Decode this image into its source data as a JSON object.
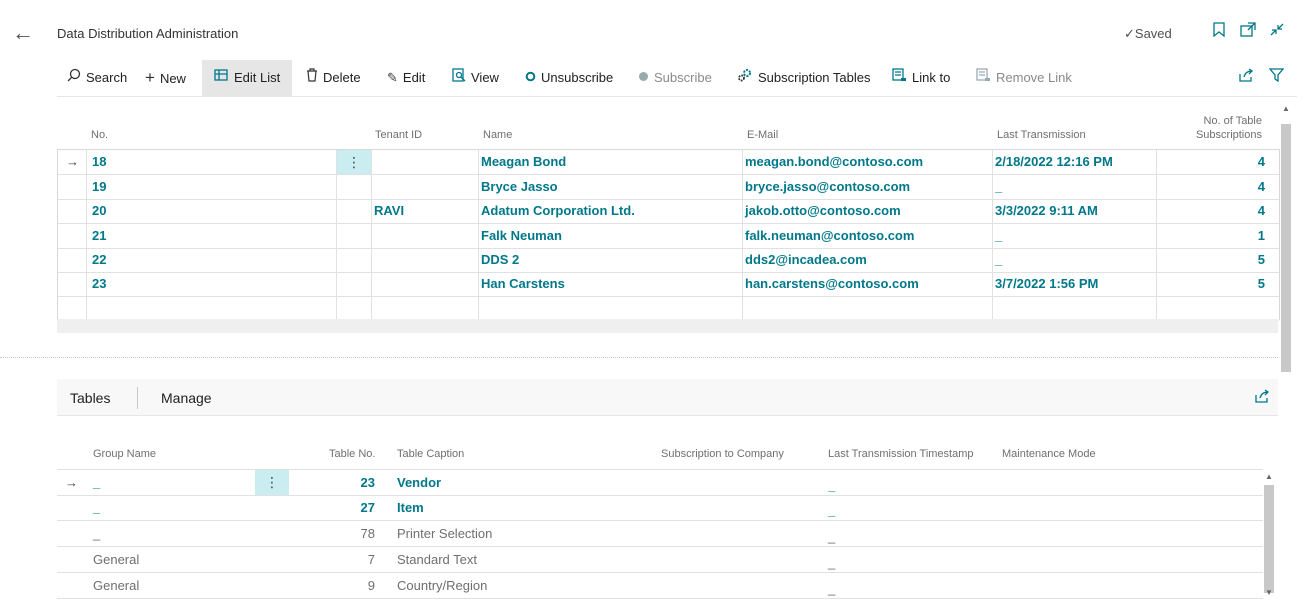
{
  "header": {
    "title": "Data Distribution Administration",
    "saved_label": "Saved"
  },
  "actions": [
    {
      "label": "Search",
      "icon": "search-icon",
      "state": "normal"
    },
    {
      "label": "New",
      "icon": "plus-icon",
      "state": "normal"
    },
    {
      "label": "Edit List",
      "icon": "edit-list-icon",
      "state": "active"
    },
    {
      "label": "Delete",
      "icon": "trash-icon",
      "state": "normal"
    },
    {
      "label": "Edit",
      "icon": "pencil-icon",
      "state": "normal"
    },
    {
      "label": "View",
      "icon": "view-icon",
      "state": "normal"
    },
    {
      "label": "Unsubscribe",
      "icon": "ring-icon",
      "state": "normal"
    },
    {
      "label": "Subscribe",
      "icon": "dot-icon",
      "state": "disabled"
    },
    {
      "label": "Subscription Tables",
      "icon": "gears-icon",
      "state": "normal"
    },
    {
      "label": "Link to",
      "icon": "link-doc-icon",
      "state": "normal"
    },
    {
      "label": "Remove Link",
      "icon": "remove-link-icon",
      "state": "disabled"
    }
  ],
  "main_grid": {
    "columns": {
      "no": "No.",
      "tenant_id": "Tenant ID",
      "name": "Name",
      "email": "E-Mail",
      "last_transmission": "Last Transmission",
      "subs_line1": "No. of Table",
      "subs_line2": "Subscriptions"
    },
    "rows": [
      {
        "no": "18",
        "tenant": "",
        "name": "Meagan Bond",
        "email": "meagan.bond@contoso.com",
        "last": "2/18/2022 12:16 PM",
        "subs": "4"
      },
      {
        "no": "19",
        "tenant": "",
        "name": "Bryce Jasso",
        "email": "bryce.jasso@contoso.com",
        "last": "_",
        "subs": "4"
      },
      {
        "no": "20",
        "tenant": "RAVI",
        "name": "Adatum Corporation Ltd.",
        "email": "jakob.otto@contoso.com",
        "last": "3/3/2022 9:11 AM",
        "subs": "4"
      },
      {
        "no": "21",
        "tenant": "",
        "name": "Falk Neuman",
        "email": "falk.neuman@contoso.com",
        "last": "_",
        "subs": "1"
      },
      {
        "no": "22",
        "tenant": "",
        "name": "DDS 2",
        "email": "dds2@incadea.com",
        "last": "_",
        "subs": "5"
      },
      {
        "no": "23",
        "tenant": "",
        "name": "Han Carstens",
        "email": "han.carstens@contoso.com",
        "last": "3/7/2022 1:56 PM",
        "subs": "5"
      }
    ]
  },
  "tables_part": {
    "tabs": [
      "Tables",
      "Manage"
    ],
    "columns": {
      "group": "Group Name",
      "table_no": "Table No.",
      "caption": "Table Caption",
      "subscription": "Subscription to Company",
      "last_ts": "Last Transmission Timestamp",
      "maintenance": "Maintenance Mode"
    },
    "rows": [
      {
        "group": "_",
        "table_no": "23",
        "caption": "Vendor",
        "last_ts": "_",
        "bold": true
      },
      {
        "group": "_",
        "table_no": "27",
        "caption": "Item",
        "last_ts": "_",
        "bold": true
      },
      {
        "group": "_",
        "table_no": "78",
        "caption": "Printer Selection",
        "last_ts": "_",
        "bold": false
      },
      {
        "group": "General",
        "table_no": "7",
        "caption": "Standard Text",
        "last_ts": "_",
        "bold": false
      },
      {
        "group": "General",
        "table_no": "9",
        "caption": "Country/Region",
        "last_ts": "_",
        "bold": false
      }
    ]
  }
}
